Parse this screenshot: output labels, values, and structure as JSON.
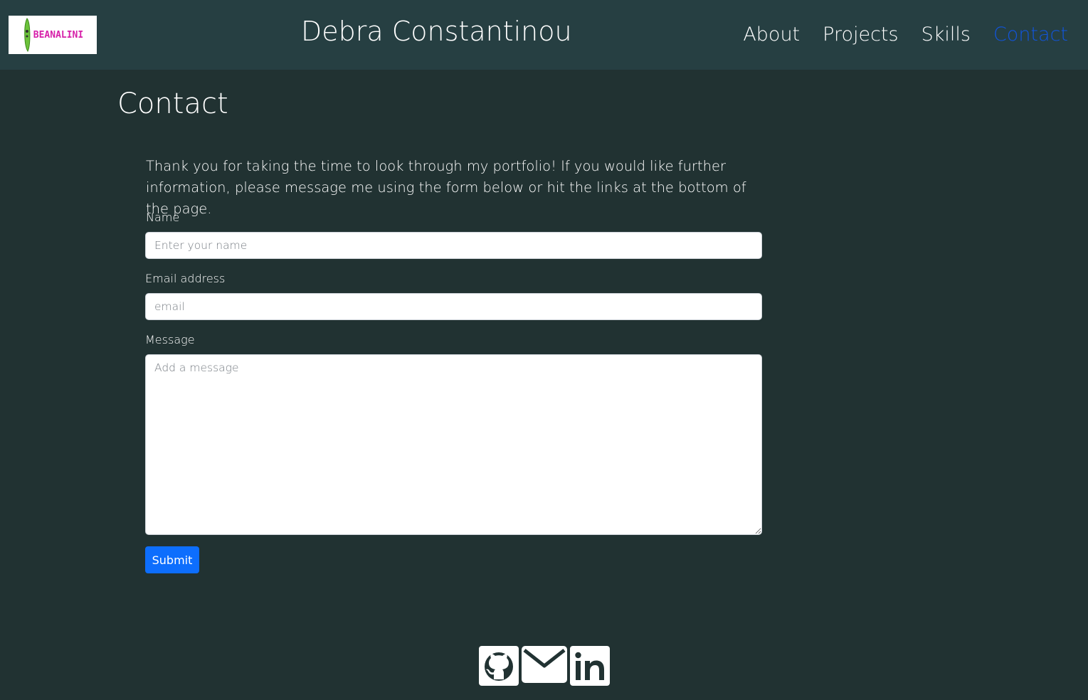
{
  "header": {
    "logo_text": "BEANALINI",
    "site_title": "Debra Constantinou",
    "nav": [
      {
        "label": "About"
      },
      {
        "label": "Projects"
      },
      {
        "label": "Skills"
      },
      {
        "label": "Contact",
        "active": true
      }
    ],
    "active_color": "#1155dd"
  },
  "main": {
    "heading": "Contact",
    "intro": "Thank you for taking the time to look through my portfolio! If you would like further information, please message me using the form below or hit the links at the bottom of the page.",
    "form": {
      "name_label": "Name",
      "name_placeholder": "Enter your name",
      "name_value": "",
      "email_label": "Email address",
      "email_placeholder": "email",
      "email_value": "",
      "message_label": "Message",
      "message_placeholder": "Add a message",
      "message_value": "",
      "submit_label": "Submit"
    }
  },
  "footer": {
    "icons": [
      "github-icon",
      "envelope-icon",
      "linkedin-icon"
    ]
  },
  "colors": {
    "background": "#213232",
    "navbar": "#263f42",
    "button": "#0d6efd"
  }
}
